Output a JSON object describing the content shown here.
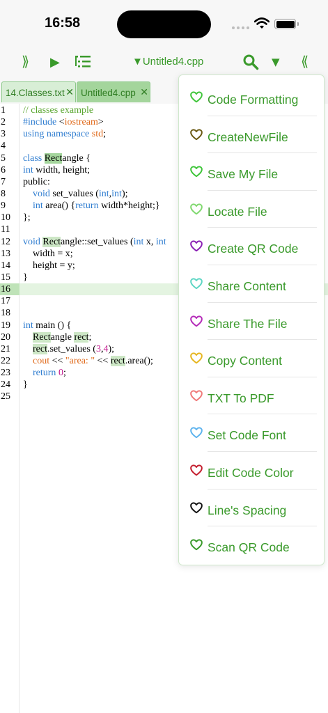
{
  "status_bar": {
    "time": "16:58"
  },
  "toolbar": {
    "expand_glyph": "⟫",
    "run_glyph": "▶",
    "outline_glyph": "outline-icon",
    "file_title": "▼Untitled4.cpp",
    "search_glyph": "search-icon",
    "dropdown_glyph": "▼",
    "collapse_glyph": "⟪"
  },
  "tabs": [
    {
      "label": "14.Classes.txt",
      "close": "✕"
    },
    {
      "label": "Untitled4.cpp",
      "close": "✕"
    }
  ],
  "editor": {
    "line_numbers": [
      "1",
      "2",
      "3",
      "4",
      "5",
      "6",
      "7",
      "8",
      "9",
      "10",
      "11",
      "12",
      "13",
      "14",
      "15",
      "16",
      "17",
      "18",
      "19",
      "20",
      "21",
      "22",
      "23",
      "24",
      "25"
    ],
    "active_line": "16",
    "lines": {
      "l1": {
        "a": "// classes example"
      },
      "l2": {
        "a": "#include ",
        "b": "<",
        "c": "iostream",
        "d": ">"
      },
      "l3": {
        "a": "using namespace ",
        "b": "std",
        "c": ";"
      },
      "l5": {
        "a": "class ",
        "b": "Rect",
        "c": "angle {"
      },
      "l6": {
        "a": "int",
        "b": " width, height;"
      },
      "l7": {
        "a": "public:"
      },
      "l8": {
        "a": "    ",
        "b": "void",
        "c": " set_values (",
        "d": "int",
        "e": ",",
        "f": "int",
        "g": ");"
      },
      "l9": {
        "a": "    ",
        "b": "int",
        "c": " area() {",
        "d": "return",
        "e": " width*height;}"
      },
      "l10": {
        "a": "};"
      },
      "l12": {
        "a": "void",
        "b": " ",
        "c": "Rect",
        "d": "angle::set_values (",
        "e": "int",
        "f": " x, ",
        "g": "int"
      },
      "l13": {
        "a": "    width = x;"
      },
      "l14": {
        "a": "    height = y;"
      },
      "l15": {
        "a": "}"
      },
      "l19": {
        "a": "int",
        "b": " main () {"
      },
      "l20": {
        "a": "    ",
        "b": "Rect",
        "c": "angle ",
        "d": "rect",
        "e": ";"
      },
      "l21": {
        "a": "    ",
        "b": "rect",
        "c": ".set_values (",
        "d": "3",
        "e": ",",
        "f": "4",
        "g": ");"
      },
      "l22": {
        "a": "    ",
        "b": "cout",
        "c": " << ",
        "d": "\"area: \"",
        "e": " << ",
        "f": "rect",
        "g": ".area();"
      },
      "l23": {
        "a": "    ",
        "b": "return",
        "c": " ",
        "d": "0",
        "e": ";"
      },
      "l24": {
        "a": "}"
      }
    }
  },
  "menu": {
    "items": [
      {
        "label": "Code Formatting",
        "icon": "heart-icon",
        "color": "#3fc53a"
      },
      {
        "label": "CreateNewFile",
        "icon": "heart-icon",
        "color": "#6b5a14"
      },
      {
        "label": "Save My File",
        "icon": "heart-icon",
        "color": "#3fc53a"
      },
      {
        "label": "Locate File",
        "icon": "heart-icon",
        "color": "#7fd86e"
      },
      {
        "label": "Create QR Code",
        "icon": "heart-icon",
        "color": "#8a1fb4"
      },
      {
        "label": "Share Content",
        "icon": "heart-icon",
        "color": "#5fd6c4"
      },
      {
        "label": "Share The File",
        "icon": "heart-icon",
        "color": "#b42ab8"
      },
      {
        "label": "Copy Content",
        "icon": "heart-icon",
        "color": "#e6b620"
      },
      {
        "label": "TXT To PDF",
        "icon": "heart-icon",
        "color": "#f07a7a"
      },
      {
        "label": "Set Code Font",
        "icon": "heart-icon",
        "color": "#5fb4ee"
      },
      {
        "label": "Edit Code Color",
        "icon": "heart-icon",
        "color": "#c41e2e"
      },
      {
        "label": "Line's Spacing",
        "icon": "heart-icon",
        "color": "#111111"
      },
      {
        "label": "Scan QR Code",
        "icon": "heart-icon",
        "color": "#3a9a2b"
      }
    ]
  }
}
